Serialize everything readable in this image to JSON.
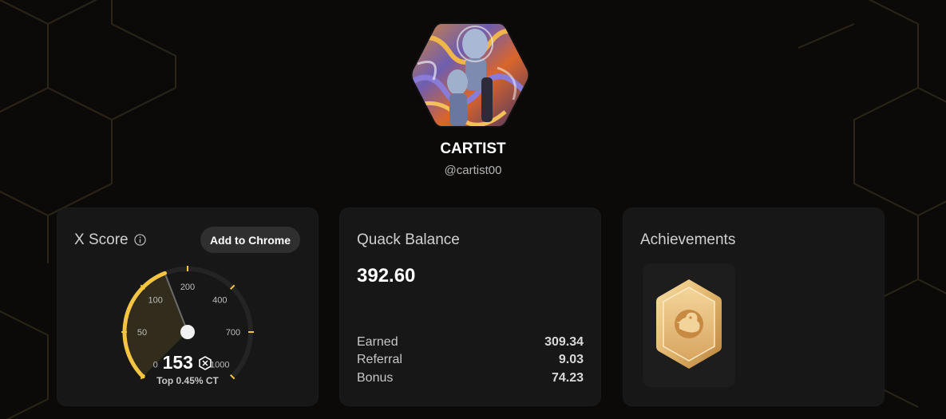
{
  "profile": {
    "name": "CARTIST",
    "handle": "@cartist00"
  },
  "xscore": {
    "title": "X Score",
    "button_label": "Add to Chrome",
    "score": 153,
    "rank_text": "Top 0.45% CT",
    "gauge_ticks": [
      "0",
      "50",
      "100",
      "200",
      "400",
      "700",
      "1000"
    ],
    "accent_color": "#f5c542"
  },
  "quack": {
    "title": "Quack Balance",
    "balance": "392.60",
    "rows": [
      {
        "label": "Earned",
        "value": "309.34"
      },
      {
        "label": "Referral",
        "value": "9.03"
      },
      {
        "label": "Bonus",
        "value": "74.23"
      }
    ]
  },
  "achievements": {
    "title": "Achievements",
    "badges": [
      "duck-badge-icon"
    ]
  }
}
